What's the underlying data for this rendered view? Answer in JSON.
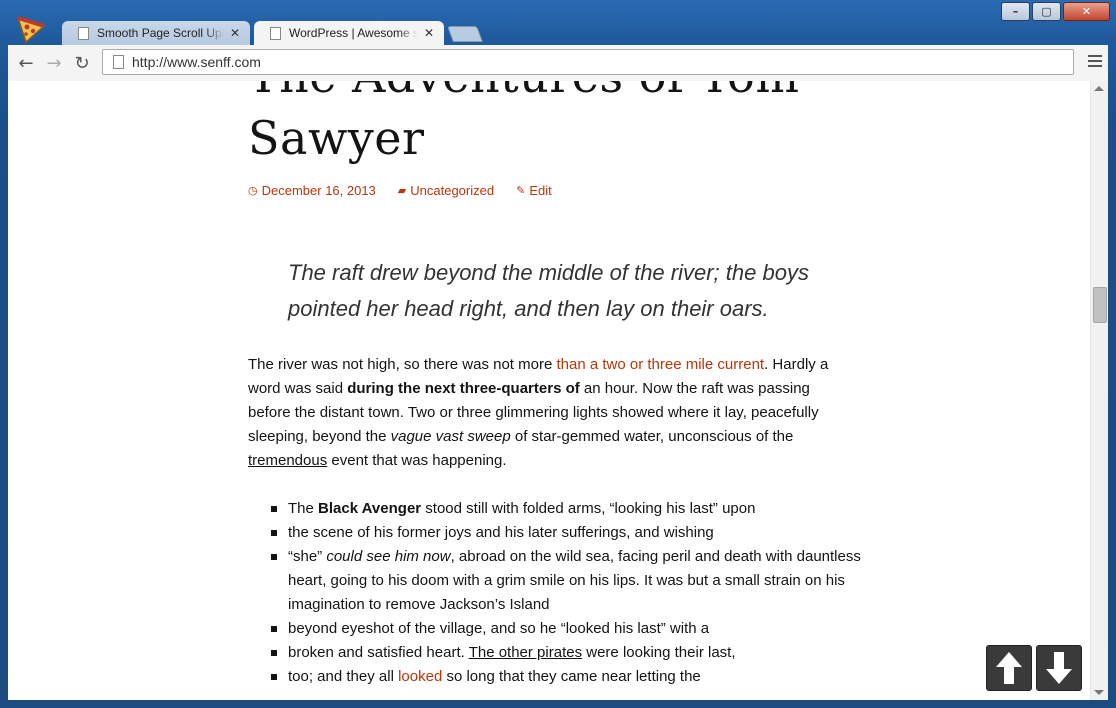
{
  "browser": {
    "tabs": [
      {
        "title": "Smooth Page Scroll Up/Down"
      },
      {
        "title": "WordPress | Awesome site"
      }
    ],
    "url": "http://www.senff.com",
    "icons": {
      "app": "pizza-icon",
      "back": "back-arrow-icon",
      "forward": "forward-arrow-icon",
      "reload": "reload-icon",
      "page": "page-icon",
      "menu": "hamburger-menu-icon"
    }
  },
  "article": {
    "title": "The Adventures of Tom Sawyer",
    "meta": {
      "date": "December 16, 2013",
      "category": "Uncategorized",
      "edit": "Edit"
    },
    "quote": "The raft drew beyond the middle of the river; the boys pointed her head right, and then lay on their oars.",
    "paragraph": {
      "p1": "The river was not high, so there was not more ",
      "link1": "than a two or three mile current",
      "p2": ". Hardly a word was said ",
      "bold1": "during the next three-quarters of",
      "p3": " an hour. Now the raft was passing before the distant town. Two or three glimmering lights showed where it lay, peacefully sleeping, beyond the ",
      "em1": "vague vast sweep",
      "p4": " of star-gemmed water, unconscious of the ",
      "u1": "tremendous",
      "p5": " event that was happening."
    },
    "list": [
      {
        "a": "The ",
        "bold": "Black Avenger",
        "b": " stood still with folded arms, “looking his last” upon"
      },
      {
        "text": "the scene of his former joys and his later sufferings, and wishing"
      },
      {
        "a": "“she” ",
        "em": "could see him now",
        "b": ", abroad on the wild sea, facing peril and death with dauntless heart, going to his doom with a grim smile on his lips. It was but a small strain on his imagination to remove Jackson’s Island"
      },
      {
        "text": "beyond eyeshot of the village, and so he “looked his last” with a"
      },
      {
        "a": "broken and satisfied heart. ",
        "u": "The other pirates",
        "b": " were looking their last,"
      },
      {
        "a": "too; and they all ",
        "link": "looked",
        "b": " so long that they came near letting the"
      }
    ]
  },
  "scroll_buttons": {
    "up": "scroll-up-arrow-icon",
    "down": "scroll-down-arrow-icon"
  },
  "colors": {
    "accent": "#bc360a",
    "frame": "#1f5a9c",
    "text": "#141412"
  }
}
